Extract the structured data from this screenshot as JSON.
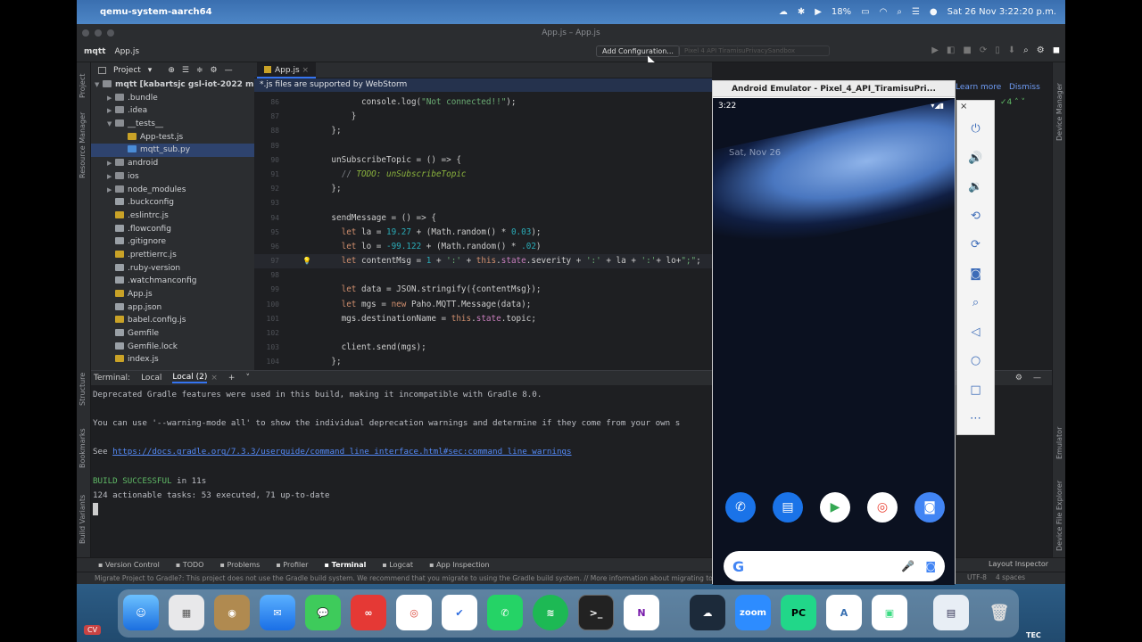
{
  "menubar": {
    "app_name": "qemu-system-aarch64",
    "battery": "18%",
    "datetime": "Sat 26 Nov  3:22:20 p.m."
  },
  "window": {
    "title": "App.js – App.js",
    "breadcrumb_project": "mqtt",
    "breadcrumb_file": "App.js",
    "add_config_label": "Add Configuration...",
    "device_label": "Pixel 4 API TiramisuPrivacySandbox"
  },
  "project_panel": {
    "header": "Project",
    "root": "mqtt [kabartsjc gsl-iot-2022 m",
    "items": [
      {
        "name": ".bundle",
        "type": "folder",
        "depth": 1,
        "arrow": "▶"
      },
      {
        "name": ".idea",
        "type": "folder",
        "depth": 1,
        "arrow": "▶"
      },
      {
        "name": "__tests__",
        "type": "folder",
        "depth": 1,
        "arrow": "▼"
      },
      {
        "name": "App-test.js",
        "type": "js",
        "depth": 2,
        "arrow": ""
      },
      {
        "name": "mqtt_sub.py",
        "type": "py",
        "depth": 2,
        "arrow": "",
        "selected": true
      },
      {
        "name": "android",
        "type": "folder",
        "depth": 1,
        "arrow": "▶"
      },
      {
        "name": "ios",
        "type": "folder",
        "depth": 1,
        "arrow": "▶"
      },
      {
        "name": "node_modules",
        "type": "folder",
        "depth": 1,
        "arrow": "▶"
      },
      {
        "name": ".buckconfig",
        "type": "cfg",
        "depth": 1,
        "arrow": ""
      },
      {
        "name": ".eslintrc.js",
        "type": "js",
        "depth": 1,
        "arrow": ""
      },
      {
        "name": ".flowconfig",
        "type": "cfg",
        "depth": 1,
        "arrow": ""
      },
      {
        "name": ".gitignore",
        "type": "cfg",
        "depth": 1,
        "arrow": ""
      },
      {
        "name": ".prettierrc.js",
        "type": "js",
        "depth": 1,
        "arrow": ""
      },
      {
        "name": ".ruby-version",
        "type": "cfg",
        "depth": 1,
        "arrow": ""
      },
      {
        "name": ".watchmanconfig",
        "type": "cfg",
        "depth": 1,
        "arrow": ""
      },
      {
        "name": "App.js",
        "type": "js",
        "depth": 1,
        "arrow": ""
      },
      {
        "name": "app.json",
        "type": "cfg",
        "depth": 1,
        "arrow": ""
      },
      {
        "name": "babel.config.js",
        "type": "js",
        "depth": 1,
        "arrow": ""
      },
      {
        "name": "Gemfile",
        "type": "cfg",
        "depth": 1,
        "arrow": ""
      },
      {
        "name": "Gemfile.lock",
        "type": "cfg",
        "depth": 1,
        "arrow": ""
      },
      {
        "name": "index.js",
        "type": "js",
        "depth": 1,
        "arrow": ""
      }
    ]
  },
  "editor": {
    "tab": "App.js",
    "banner": "*.js files are supported by WebStorm",
    "learn_more": "Learn more",
    "dismiss": "Dismiss",
    "inspections": "4",
    "lines": [
      {
        "n": "86",
        "html": "          console.log(<span class='str'>\"Not connected!!\"</span>);"
      },
      {
        "n": "87",
        "html": "        }"
      },
      {
        "n": "88",
        "html": "    };"
      },
      {
        "n": "89",
        "html": ""
      },
      {
        "n": "90",
        "html": "    unSubscribeTopic = () => {"
      },
      {
        "n": "91",
        "html": "      <span class='cm'>// </span><span class='td'>TODO: unSubscribeTopic</span>"
      },
      {
        "n": "92",
        "html": "    };"
      },
      {
        "n": "93",
        "html": ""
      },
      {
        "n": "94",
        "html": "    sendMessage = () => {"
      },
      {
        "n": "95",
        "html": "      <span class='kw'>let</span> la = <span class='num'>19.27</span> + (Math.random() * <span class='num'>0.03</span>);"
      },
      {
        "n": "96",
        "html": "      <span class='kw'>let</span> lo = <span class='num'>-99.122</span> + (Math.random() * <span class='num'>.02</span>)"
      },
      {
        "n": "97",
        "html": "      <span class='kw'>let</span> contentMsg = <span class='num'>1</span> + <span class='str'>':'</span> + <span class='kw'>this</span>.<span class='prop'>state</span>.severity + <span class='str'>':'</span> + la + <span class='str'>':'</span>+ lo+<span class='str'>\";\"</span>;",
        "current": true
      },
      {
        "n": "98",
        "html": ""
      },
      {
        "n": "99",
        "html": "      <span class='kw'>let</span> data = JSON.stringify({contentMsg});"
      },
      {
        "n": "100",
        "html": "      <span class='kw'>let</span> mgs = <span class='kw'>new</span> Paho.MQTT.Message(data);"
      },
      {
        "n": "101",
        "html": "      mgs.destinationName = <span class='kw'>this</span>.<span class='prop'>state</span>.topic;"
      },
      {
        "n": "102",
        "html": ""
      },
      {
        "n": "103",
        "html": "      client.send(mgs);"
      },
      {
        "n": "104",
        "html": "    };"
      }
    ]
  },
  "terminal": {
    "label": "Terminal:",
    "tabs": [
      "Local",
      "Local (2)"
    ],
    "lines": [
      {
        "text": "Deprecated Gradle features were used in this build, making it incompatible with Gradle 8.0."
      },
      {
        "text": ""
      },
      {
        "text": "You can use '--warning-mode all' to show the individual deprecation warnings and determine if they come from your own s"
      },
      {
        "text": ""
      },
      {
        "prefix": "See ",
        "link": "https://docs.gradle.org/7.3.3/userguide/command_line_interface.html#sec:command_line_warnings"
      },
      {
        "text": ""
      },
      {
        "green": "BUILD SUCCESSFUL",
        "text": " in 11s"
      },
      {
        "text": "124 actionable tasks: 53 executed, 71 up-to-date"
      }
    ]
  },
  "toolwindows": [
    "Version Control",
    "TODO",
    "Problems",
    "Profiler",
    "Terminal",
    "Logcat",
    "App Inspection"
  ],
  "toolwindows_right": "Layout Inspector",
  "status": {
    "message": "Migrate Project to Gradle?: This project does not use the Gradle build system. We recommend that you migrate to using the Gradle build system. // More information about migrating to Gra",
    "encoding": "UTF-8",
    "indent": "4 spaces"
  },
  "left_strip": [
    "Project",
    "Resource Manager",
    "Structure",
    "Bookmarks",
    "Build Variants"
  ],
  "right_strip": [
    "Device Manager",
    "Emulator",
    "Device File Explorer"
  ],
  "emulator": {
    "title": "Android Emulator - Pixel_4_API_TiramisuPri...",
    "time": "3:22",
    "date": "Sat, Nov 26",
    "side_buttons": [
      "power-icon",
      "volume-up-icon",
      "volume-down-icon",
      "rotate-left-icon",
      "rotate-right-icon",
      "camera-icon",
      "zoom-icon",
      "back-icon",
      "home-icon",
      "overview-icon",
      "more-icon"
    ]
  },
  "dock": {
    "zoom_label": "zoom",
    "pc_label": "PC"
  },
  "overlay": {
    "cv_badge": "CV",
    "tec_label": "TEC"
  },
  "colors": {
    "accent": "#3574f0",
    "ide_bg": "#1e1f22",
    "panel_bg": "#2b2d30"
  }
}
